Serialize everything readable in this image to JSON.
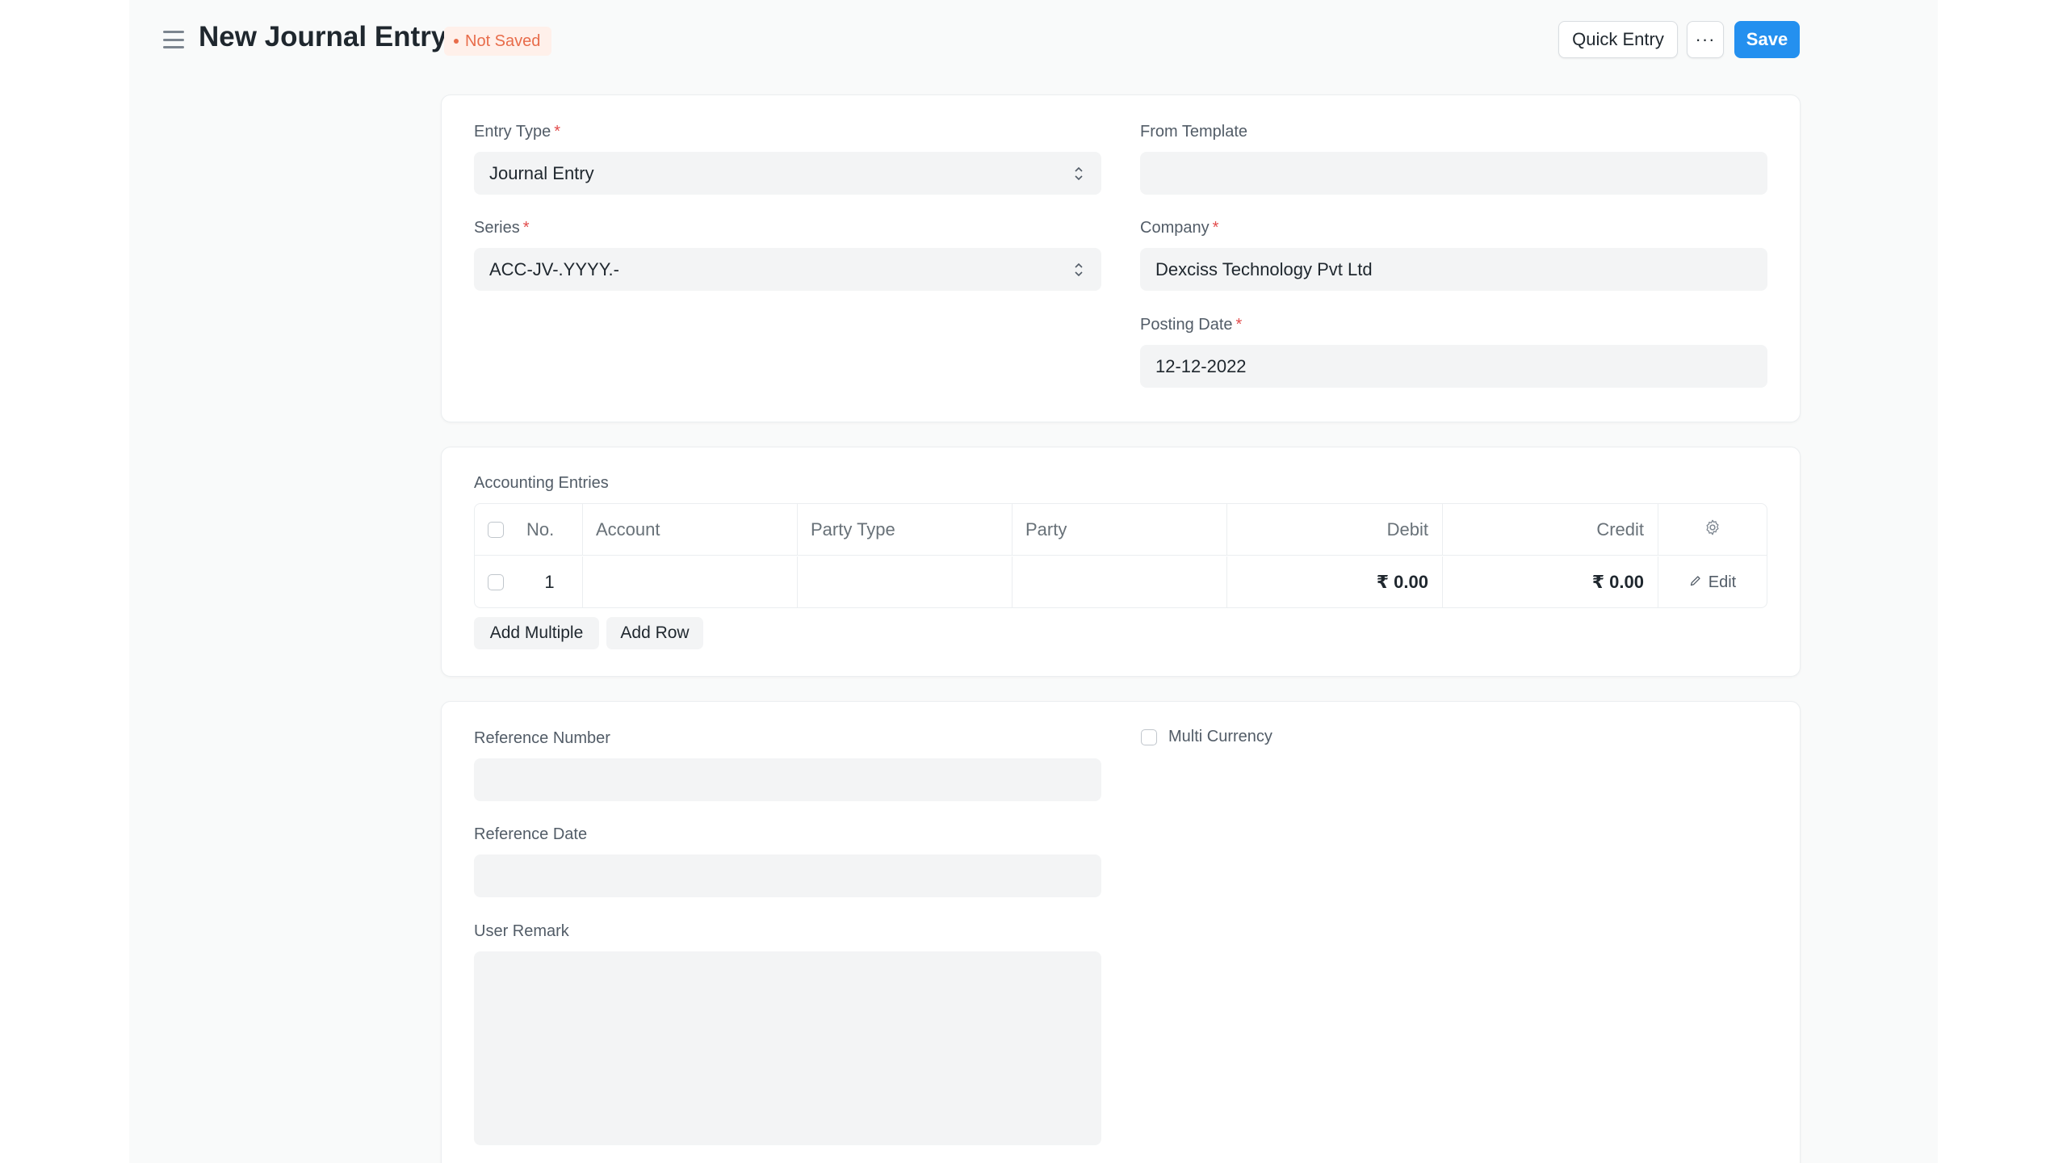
{
  "header": {
    "title": "New Journal Entry",
    "status": "Not Saved",
    "quick_entry_label": "Quick Entry",
    "more_label": "···",
    "save_label": "Save"
  },
  "details": {
    "entry_type": {
      "label": "Entry Type",
      "value": "Journal Entry",
      "required": true
    },
    "from_template": {
      "label": "From Template",
      "value": ""
    },
    "series": {
      "label": "Series",
      "value": "ACC-JV-.YYYY.-",
      "required": true
    },
    "company": {
      "label": "Company",
      "value": "Dexciss Technology Pvt Ltd",
      "required": true
    },
    "posting_date": {
      "label": "Posting Date",
      "value": "12-12-2022",
      "required": true
    },
    "required_marker": "*"
  },
  "accounting": {
    "section_label": "Accounting Entries",
    "columns": {
      "no": "No.",
      "account": "Account",
      "party_type": "Party Type",
      "party": "Party",
      "debit": "Debit",
      "credit": "Credit"
    },
    "rows": [
      {
        "no": "1",
        "account": "",
        "party_type": "",
        "party": "",
        "debit": "₹ 0.00",
        "credit": "₹ 0.00",
        "edit_label": "Edit"
      }
    ],
    "add_multiple_label": "Add Multiple",
    "add_row_label": "Add Row"
  },
  "reference": {
    "reference_number": {
      "label": "Reference Number",
      "value": ""
    },
    "reference_date": {
      "label": "Reference Date",
      "value": ""
    },
    "user_remark": {
      "label": "User Remark",
      "value": ""
    },
    "multi_currency": {
      "label": "Multi Currency",
      "checked": false
    }
  },
  "colors": {
    "primary": "#2490ef",
    "status_text": "#e86c4a",
    "status_bg": "#fff0ea",
    "required": "#e24c4c",
    "input_bg": "#f3f4f5",
    "page_bg": "#f9fafa"
  },
  "icons": {
    "menu": "hamburger-icon",
    "select": "chevron-up-down-icon",
    "settings": "gear-icon",
    "edit": "pencil-icon",
    "resize": "resize-handle-icon"
  }
}
